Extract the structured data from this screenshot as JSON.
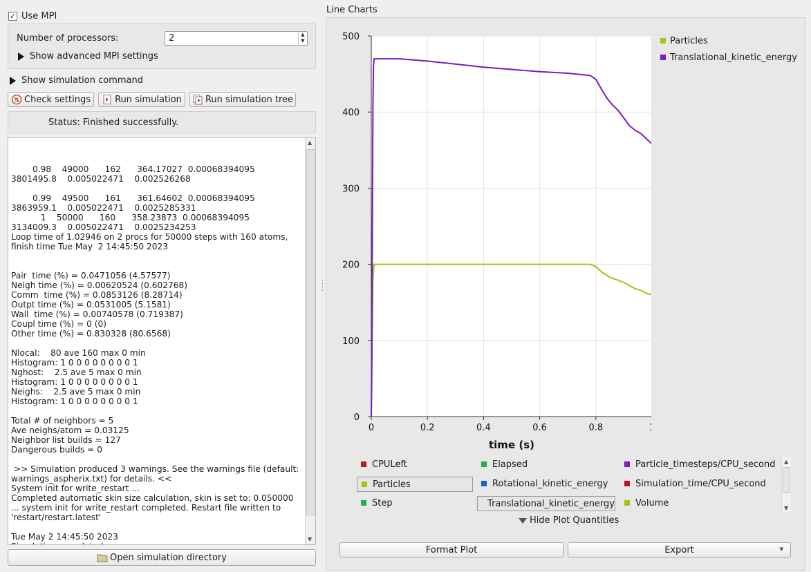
{
  "mpi": {
    "use_mpi_label": "Use MPI",
    "use_mpi_checked": true,
    "processors_label": "Number of processors:",
    "processors_value": "2",
    "advanced_label": "Show advanced MPI settings"
  },
  "simulation": {
    "show_command_label": "Show simulation command",
    "check_settings_label": "Check settings",
    "run_simulation_label": "Run simulation",
    "run_tree_label": "Run simulation tree",
    "status_text": "Status: Finished successfully.",
    "open_dir_label": "Open simulation directory"
  },
  "log": {
    "text": "        0.98    49000      162      364.17027  0.00068394095 \n3801495.8    0.005022471    0.002526268 \n\n        0.99    49500      161      361.64602  0.00068394095 \n3863959.1    0.005022471    0.0025285331 \n           1    50000      160      358.23873  0.00068394095 \n3134009.3    0.005022471    0.0025234253 \nLoop time of 1.02946 on 2 procs for 50000 steps with 160 atoms,\nfinish time Tue May  2 14:45:50 2023\n\n\nPair  time (%) = 0.0471056 (4.57577)\nNeigh time (%) = 0.00620524 (0.602768)\nComm  time (%) = 0.0853126 (8.28714)\nOutpt time (%) = 0.0531005 (5.1581)\nWall  time (%) = 0.00740578 (0.719387)\nCoupl time (%) = 0 (0)\nOther time (%) = 0.830328 (80.6568)\n\nNlocal:    80 ave 160 max 0 min\nHistogram: 1 0 0 0 0 0 0 0 0 1\nNghost:    2.5 ave 5 max 0 min\nHistogram: 1 0 0 0 0 0 0 0 0 1\nNeighs:    2.5 ave 5 max 0 min\nHistogram: 1 0 0 0 0 0 0 0 0 1\n\nTotal # of neighbors = 5\nAve neighs/atom = 0.03125\nNeighbor list builds = 127\nDangerous builds = 0\n\n >> Simulation produced 3 warnings. See the warnings file (default:\nwarnings_aspherix.txt) for details. <<\nSystem init for write_restart ...\nCompleted automatic skin size calculation, skin is set to: 0.050000\n... system init for write_restart completed. Restart file written to\n'restart/restart.latest'\n\nTue May 2 14:45:50 2023\nSimulation completed"
  },
  "chart_panel": {
    "title": "Line Charts",
    "format_plot_label": "Format Plot",
    "export_label": "Export",
    "hide_quantities_label": "Hide Plot Quantities"
  },
  "quantities": [
    {
      "name": "CPULeft",
      "color": "#c0161e",
      "selected": false
    },
    {
      "name": "Elapsed",
      "color": "#1eb04a",
      "selected": false
    },
    {
      "name": "Particle_timesteps/CPU_second",
      "color": "#7b18c8",
      "selected": false
    },
    {
      "name": "Particles",
      "color": "#a6c30f",
      "selected": true
    },
    {
      "name": "Rotational_kinetic_energy",
      "color": "#1a5fc8",
      "selected": false
    },
    {
      "name": "Simulation_time/CPU_second",
      "color": "#c0161e",
      "selected": false
    },
    {
      "name": "Step",
      "color": "#1eb04a",
      "selected": false
    },
    {
      "name": "Translational_kinetic_energy",
      "color": "#7b18c8",
      "selected": true
    },
    {
      "name": "Volume",
      "color": "#a6c30f",
      "selected": false
    }
  ],
  "chart_data": {
    "type": "line",
    "xlabel": "time (s)",
    "ylabel": "",
    "xlim": [
      0,
      1
    ],
    "ylim": [
      0,
      500
    ],
    "x_ticks": [
      "0",
      "0.2",
      "0.4",
      "0.6",
      "0.8",
      "1"
    ],
    "y_ticks": [
      "0",
      "100",
      "200",
      "300",
      "400",
      "500"
    ],
    "grid": true,
    "legend_position": "right",
    "series": [
      {
        "name": "Particles",
        "color": "#a6c30f",
        "x": [
          0,
          0.002,
          0.004,
          0.006,
          0.008,
          0.01,
          0.2,
          0.4,
          0.6,
          0.78,
          0.8,
          0.82,
          0.85,
          0.88,
          0.9,
          0.92,
          0.94,
          0.96,
          0.98,
          1.0
        ],
        "y": [
          0,
          40,
          120,
          180,
          190,
          200,
          200,
          200,
          200,
          200,
          197,
          190,
          183,
          179,
          176,
          172,
          168,
          166,
          162,
          160
        ]
      },
      {
        "name": "Translational_kinetic_energy",
        "color": "#7b18c8",
        "x": [
          0,
          0.002,
          0.004,
          0.006,
          0.008,
          0.01,
          0.05,
          0.1,
          0.2,
          0.3,
          0.4,
          0.5,
          0.6,
          0.7,
          0.78,
          0.8,
          0.82,
          0.84,
          0.86,
          0.88,
          0.9,
          0.92,
          0.94,
          0.96,
          0.98,
          1.0
        ],
        "y": [
          0,
          80,
          250,
          410,
          460,
          470,
          470,
          470,
          467,
          463,
          459,
          456,
          453,
          451,
          448,
          443,
          430,
          418,
          409,
          402,
          392,
          382,
          376,
          372,
          365,
          358
        ]
      }
    ]
  }
}
